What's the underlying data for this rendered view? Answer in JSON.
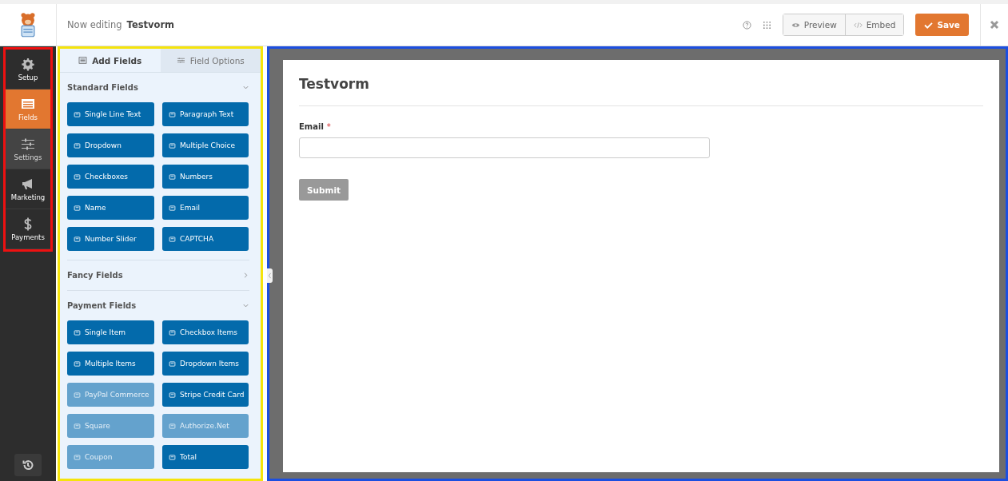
{
  "header": {
    "prefix": "Now editing",
    "form_name": "Testvorm",
    "preview": "Preview",
    "embed": "Embed",
    "save": "Save"
  },
  "nav": [
    {
      "label": "Setup",
      "selected": false,
      "hovered": false
    },
    {
      "label": "Fields",
      "selected": true,
      "hovered": false
    },
    {
      "label": "Settings",
      "selected": false,
      "hovered": true
    },
    {
      "label": "Marketing",
      "selected": false,
      "hovered": false
    },
    {
      "label": "Payments",
      "selected": false,
      "hovered": false
    }
  ],
  "tabs": [
    {
      "label": "Add Fields",
      "selected": true
    },
    {
      "label": "Field Options",
      "selected": false
    }
  ],
  "sections": [
    {
      "title": "Standard Fields",
      "expanded": true,
      "fields": [
        {
          "label": "Single Line Text",
          "disabled": false
        },
        {
          "label": "Paragraph Text",
          "disabled": false
        },
        {
          "label": "Dropdown",
          "disabled": false
        },
        {
          "label": "Multiple Choice",
          "disabled": false
        },
        {
          "label": "Checkboxes",
          "disabled": false
        },
        {
          "label": "Numbers",
          "disabled": false
        },
        {
          "label": "Name",
          "disabled": false
        },
        {
          "label": "Email",
          "disabled": false
        },
        {
          "label": "Number Slider",
          "disabled": false
        },
        {
          "label": "CAPTCHA",
          "disabled": false
        }
      ]
    },
    {
      "title": "Fancy Fields",
      "expanded": false
    },
    {
      "title": "Payment Fields",
      "expanded": true,
      "fields": [
        {
          "label": "Single Item",
          "disabled": false
        },
        {
          "label": "Checkbox Items",
          "disabled": false
        },
        {
          "label": "Multiple Items",
          "disabled": false
        },
        {
          "label": "Dropdown Items",
          "disabled": false
        },
        {
          "label": "PayPal Commerce",
          "disabled": true
        },
        {
          "label": "Stripe Credit Card",
          "disabled": false
        },
        {
          "label": "Square",
          "disabled": true
        },
        {
          "label": "Authorize.Net",
          "disabled": true
        },
        {
          "label": "Coupon",
          "disabled": true
        },
        {
          "label": "Total",
          "disabled": false
        }
      ]
    }
  ],
  "form": {
    "title": "Testvorm",
    "field_label": "Email",
    "required": "*",
    "submit": "Submit"
  }
}
